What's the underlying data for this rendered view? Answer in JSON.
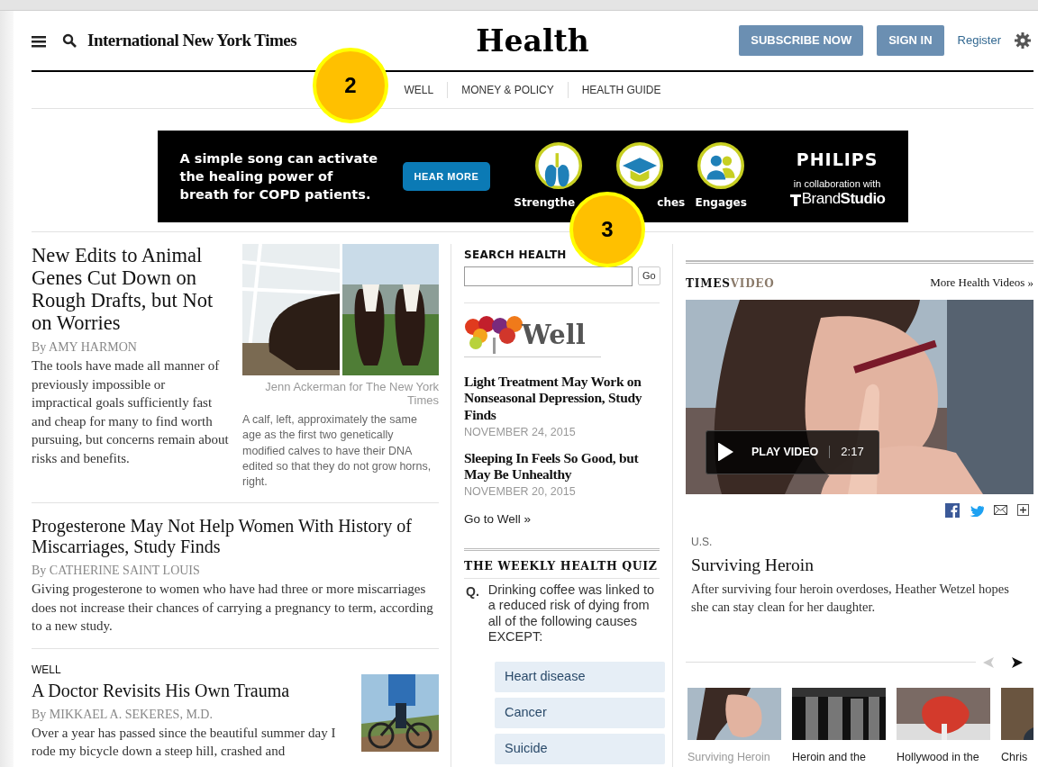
{
  "header": {
    "logo": "International New York Times",
    "section_title": "Health",
    "buttons": [
      "SUBSCRIBE NOW",
      "SIGN IN"
    ],
    "register": "Register"
  },
  "nav": [
    {
      "label": "WELL"
    },
    {
      "label": "MONEY & POLICY"
    },
    {
      "label": "HEALTH GUIDE"
    }
  ],
  "annotations": [
    {
      "label": "2"
    },
    {
      "label": "3"
    }
  ],
  "ad": {
    "text": "A simple song can activate the healing power of breath for COPD patients.",
    "button": "HEAR MORE",
    "features": [
      {
        "kind": "lungs",
        "label": "Strengthe"
      },
      {
        "kind": "cap",
        "label": "ches"
      },
      {
        "kind": "people",
        "label": "Engages"
      }
    ],
    "brand": "PHILIPS",
    "collab": "in collaboration with",
    "studio": "Brand**Studio**"
  },
  "articles": [
    {
      "headline": "New Edits to Animal Genes Cut Down on Rough Drafts, but Not on Worries",
      "byline": "By AMY HARMON",
      "summary": "The tools have made all manner of previously impossible or impractical goals sufficiently fast and cheap for many to find worth pursuing, but concerns remain about risks and benefits.",
      "image": {
        "kind": "cows",
        "credit": "Jenn Ackerman for The New York Times",
        "caption": "A calf, left, approximately the same age as the first two genetically modified calves to have their DNA edited so that they do not grow horns, right."
      }
    },
    {
      "headline": "Progesterone May Not Help Women With History of Miscarriages, Study Finds",
      "byline": "By CATHERINE SAINT LOUIS",
      "summary": "Giving progesterone to women who have had three or more miscarriages does not increase their chances of carrying a pregnancy to term, according to a new study."
    },
    {
      "kicker": "WELL",
      "headline": "A Doctor Revisits His Own Trauma",
      "byline": "By MIKKAEL A. SEKERES, M.D.",
      "summary": "Over a year has passed since the beautiful summer day I rode my bicycle down a steep hill, crashed and",
      "image": {
        "kind": "cyclist"
      }
    }
  ],
  "search": {
    "label": "SEARCH HEALTH",
    "button": "Go"
  },
  "well": {
    "logo": "Well",
    "articles": [
      {
        "headline": "Light Treatment May Work on Nonseasonal Depression, Study Finds",
        "date": "NOVEMBER 24, 2015"
      },
      {
        "headline": "Sleeping In Feels So Good, but May Be Unhealthy",
        "date": "NOVEMBER 20, 2015"
      }
    ],
    "link": "Go to Well »"
  },
  "quiz": {
    "title": "THE WEEKLY HEALTH QUIZ",
    "marker": "Q.",
    "question": "Drinking coffee was linked to a reduced risk of dying from all of the following causes EXCEPT:",
    "answers": [
      "Heart disease",
      "Cancer",
      "Suicide"
    ]
  },
  "video": {
    "brand": "TIMES",
    "brand_light": "VIDEO",
    "more": "More Health Videos »",
    "play": "PLAY VIDEO",
    "duration": "2:17",
    "kicker": "U.S.",
    "title": "Surviving Heroin",
    "summary": "After surviving four heroin overdoses, Heather Wetzel hopes she can stay clean for her daughter.",
    "prev_disabled": true,
    "thumbnails": [
      {
        "kind": "woman",
        "caption": "Surviving Heroin",
        "selected": true
      },
      {
        "kind": "crowd",
        "caption": "Heroin and the",
        "selected": false
      },
      {
        "kind": "heart",
        "caption": "Hollywood in the",
        "selected": false
      },
      {
        "kind": "man",
        "caption": "Chris",
        "selected": false
      }
    ]
  }
}
